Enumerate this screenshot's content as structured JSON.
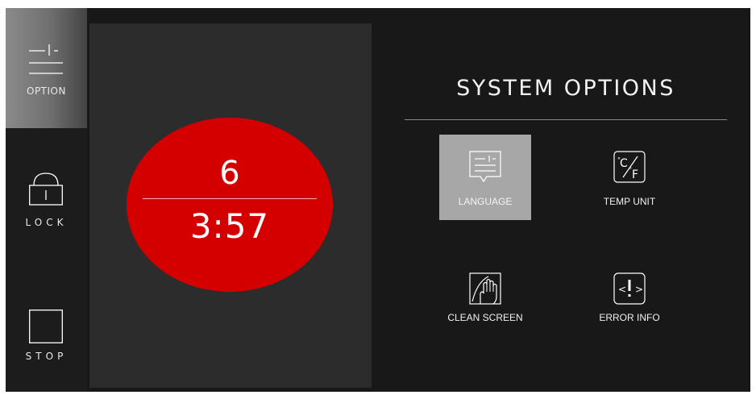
{
  "sidebar": {
    "option_label": "OPTION",
    "lock_label": "LOCK",
    "stop_label": "STOP"
  },
  "cooking": {
    "level": "6",
    "time": "3:57"
  },
  "options": {
    "title": "SYSTEM OPTIONS",
    "items": [
      {
        "label": "LANGUAGE",
        "icon": "language-icon",
        "selected": true
      },
      {
        "label": "TEMP UNIT",
        "icon": "temp-unit-icon",
        "selected": false
      },
      {
        "label": "CLEAN SCREEN",
        "icon": "clean-screen-icon",
        "selected": false
      },
      {
        "label": "ERROR INFO",
        "icon": "error-info-icon",
        "selected": false
      }
    ]
  },
  "colors": {
    "background": "#181818",
    "panel": "#2c2c2c",
    "timer_red": "#d40000",
    "selected_tile": "#a7a7a7"
  }
}
